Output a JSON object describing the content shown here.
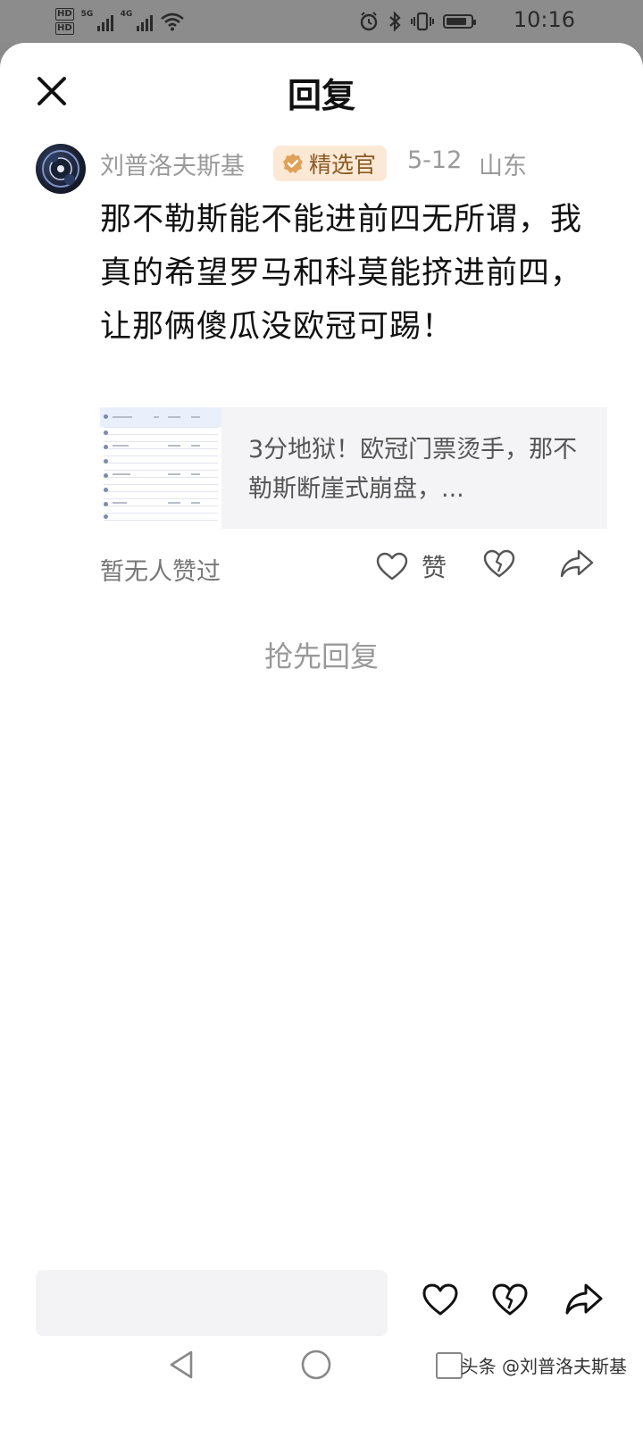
{
  "status_bar": {
    "hd_top": "HD",
    "hd_bottom": "HD",
    "sig1_label": "5G",
    "sig2_label": "4G",
    "time": "10:16",
    "icons": [
      "alarm-icon",
      "bluetooth-icon",
      "vibrate-icon",
      "battery-icon"
    ],
    "battery_level": 0.85
  },
  "header": {
    "title": "回复",
    "close_icon": "close-icon"
  },
  "comment": {
    "author": "刘普洛夫斯基",
    "badge_label": "精选官",
    "date": "5-12",
    "location": "山东",
    "text": "那不勒斯能不能进前四无所谓，我真的希望罗马和科莫能挤进前四，让那俩傻瓜没欧冠可踢！",
    "link_card": {
      "title": "3分地狱！欧冠门票烫手，那不勒斯断崖式崩盘，..."
    },
    "likes_status": "暂无人赞过",
    "like_label": "赞"
  },
  "empty_state": {
    "first_reply": "抢先回复"
  },
  "bottom_bar": {
    "input_placeholder": ""
  },
  "watermark": "头条 @刘普洛夫斯基",
  "colors": {
    "badge_bg": "#fbe9d6",
    "badge_text": "#8a5a22",
    "badge_icon": "#e0a158",
    "muted_text": "#9a9a9a"
  }
}
